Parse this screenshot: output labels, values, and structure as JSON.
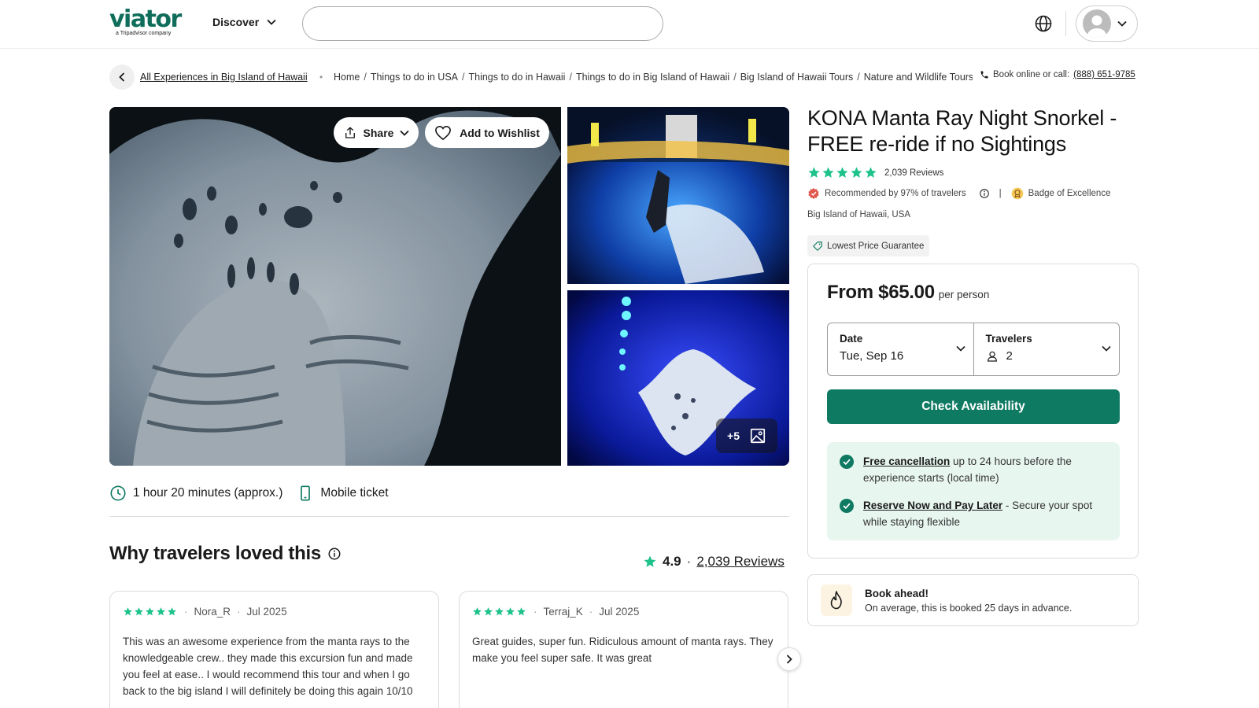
{
  "header": {
    "logo_text": "viator",
    "logo_sub": "a Tripadvisor company",
    "discover_label": "Discover",
    "search_placeholder": "",
    "icons": [
      "globe-icon",
      "avatar-icon",
      "chevron-down-icon"
    ]
  },
  "breadcrumb": {
    "all_experiences": "All Experiences in Big Island of Hawaii",
    "items": [
      "Home",
      "Things to do in USA",
      "Things to do in Hawaii",
      "Things to do in Big Island of Hawaii",
      "Big Island of Hawaii Tours",
      "Nature and Wildlife Tours"
    ],
    "book_online_label": "Book online or call:",
    "phone": "(888) 651-9785"
  },
  "gallery": {
    "share_label": "Share",
    "wishlist_label": "Add to Wishlist",
    "more_photos": "+5"
  },
  "features": {
    "duration": "1 hour 20 minutes (approx.)",
    "ticket": "Mobile ticket"
  },
  "why": {
    "title": "Why travelers loved this",
    "score": "4.9",
    "reviews_link": "2,039 Reviews",
    "reviews": [
      {
        "author": "Nora_R",
        "date": "Jul 2025",
        "stars": 5,
        "text": "This was an awesome experience from the manta rays to the knowledgeable crew.. they made this excursion fun and made you feel at ease.. I would recommend this tour and when I go back to the big island I will definitely be doing this again 10/10"
      },
      {
        "author": "Terraj_K",
        "date": "Jul 2025",
        "stars": 5,
        "text": "Great guides, super fun. Ridiculous amount of manta rays. They make you feel super safe. It was great"
      }
    ]
  },
  "product": {
    "title": "KONA Manta Ray Night Snorkel - FREE re-ride if no Sightings",
    "review_count": "2,039 Reviews",
    "rating_stars": 5,
    "recommended": "Recommended by 97% of travelers",
    "badge": "Badge of Excellence",
    "location": "Big Island of Hawaii, USA",
    "lowest_price": "Lowest Price Guarantee"
  },
  "booking": {
    "from_price": "From $65.00",
    "per_person": "per person",
    "date_label": "Date",
    "date_value": "Tue, Sep 16",
    "travelers_label": "Travelers",
    "travelers_value": "2",
    "check_label": "Check Availability",
    "free_cancel_link": "Free cancellation",
    "free_cancel_text": " up to 24 hours before the experience starts (local time)",
    "reserve_link": "Reserve Now and Pay Later",
    "reserve_text": " - Secure your spot while staying flexible"
  },
  "book_ahead": {
    "title": "Book ahead!",
    "subtitle": "On average, this is booked 25 days in advance."
  },
  "colors": {
    "brand": "#0f6d5a",
    "button": "#0f7a62",
    "star": "#1ec28b",
    "benefit_bg": "#e8f6f0"
  }
}
